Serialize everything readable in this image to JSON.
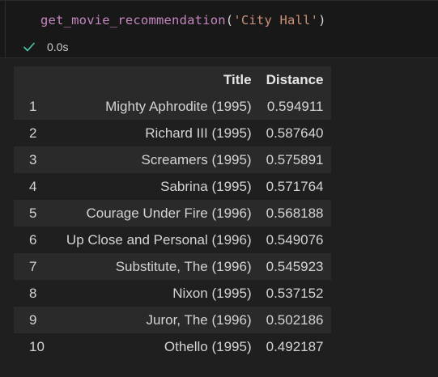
{
  "cell": {
    "code_function": "get_movie_recommendation",
    "code_open": "(",
    "code_argument": "'City Hall'",
    "code_close": ")",
    "status_icon": "check-icon",
    "execution_time": "0.0s"
  },
  "colors": {
    "function": "#c586c0",
    "string": "#ce9178",
    "success": "#4ec9b0",
    "row_stripe": "#2a2a2a",
    "background": "#1f1f1f"
  },
  "table": {
    "columns": [
      "",
      "Title",
      "Distance"
    ],
    "rows": [
      {
        "index": "1",
        "title": "Mighty Aphrodite (1995)",
        "distance": "0.594911"
      },
      {
        "index": "2",
        "title": "Richard III (1995)",
        "distance": "0.587640"
      },
      {
        "index": "3",
        "title": "Screamers (1995)",
        "distance": "0.575891"
      },
      {
        "index": "4",
        "title": "Sabrina (1995)",
        "distance": "0.571764"
      },
      {
        "index": "5",
        "title": "Courage Under Fire (1996)",
        "distance": "0.568188"
      },
      {
        "index": "6",
        "title": "Up Close and Personal (1996)",
        "distance": "0.549076"
      },
      {
        "index": "7",
        "title": "Substitute, The (1996)",
        "distance": "0.545923"
      },
      {
        "index": "8",
        "title": "Nixon (1995)",
        "distance": "0.537152"
      },
      {
        "index": "9",
        "title": "Juror, The (1996)",
        "distance": "0.502186"
      },
      {
        "index": "10",
        "title": "Othello (1995)",
        "distance": "0.492187"
      }
    ]
  }
}
